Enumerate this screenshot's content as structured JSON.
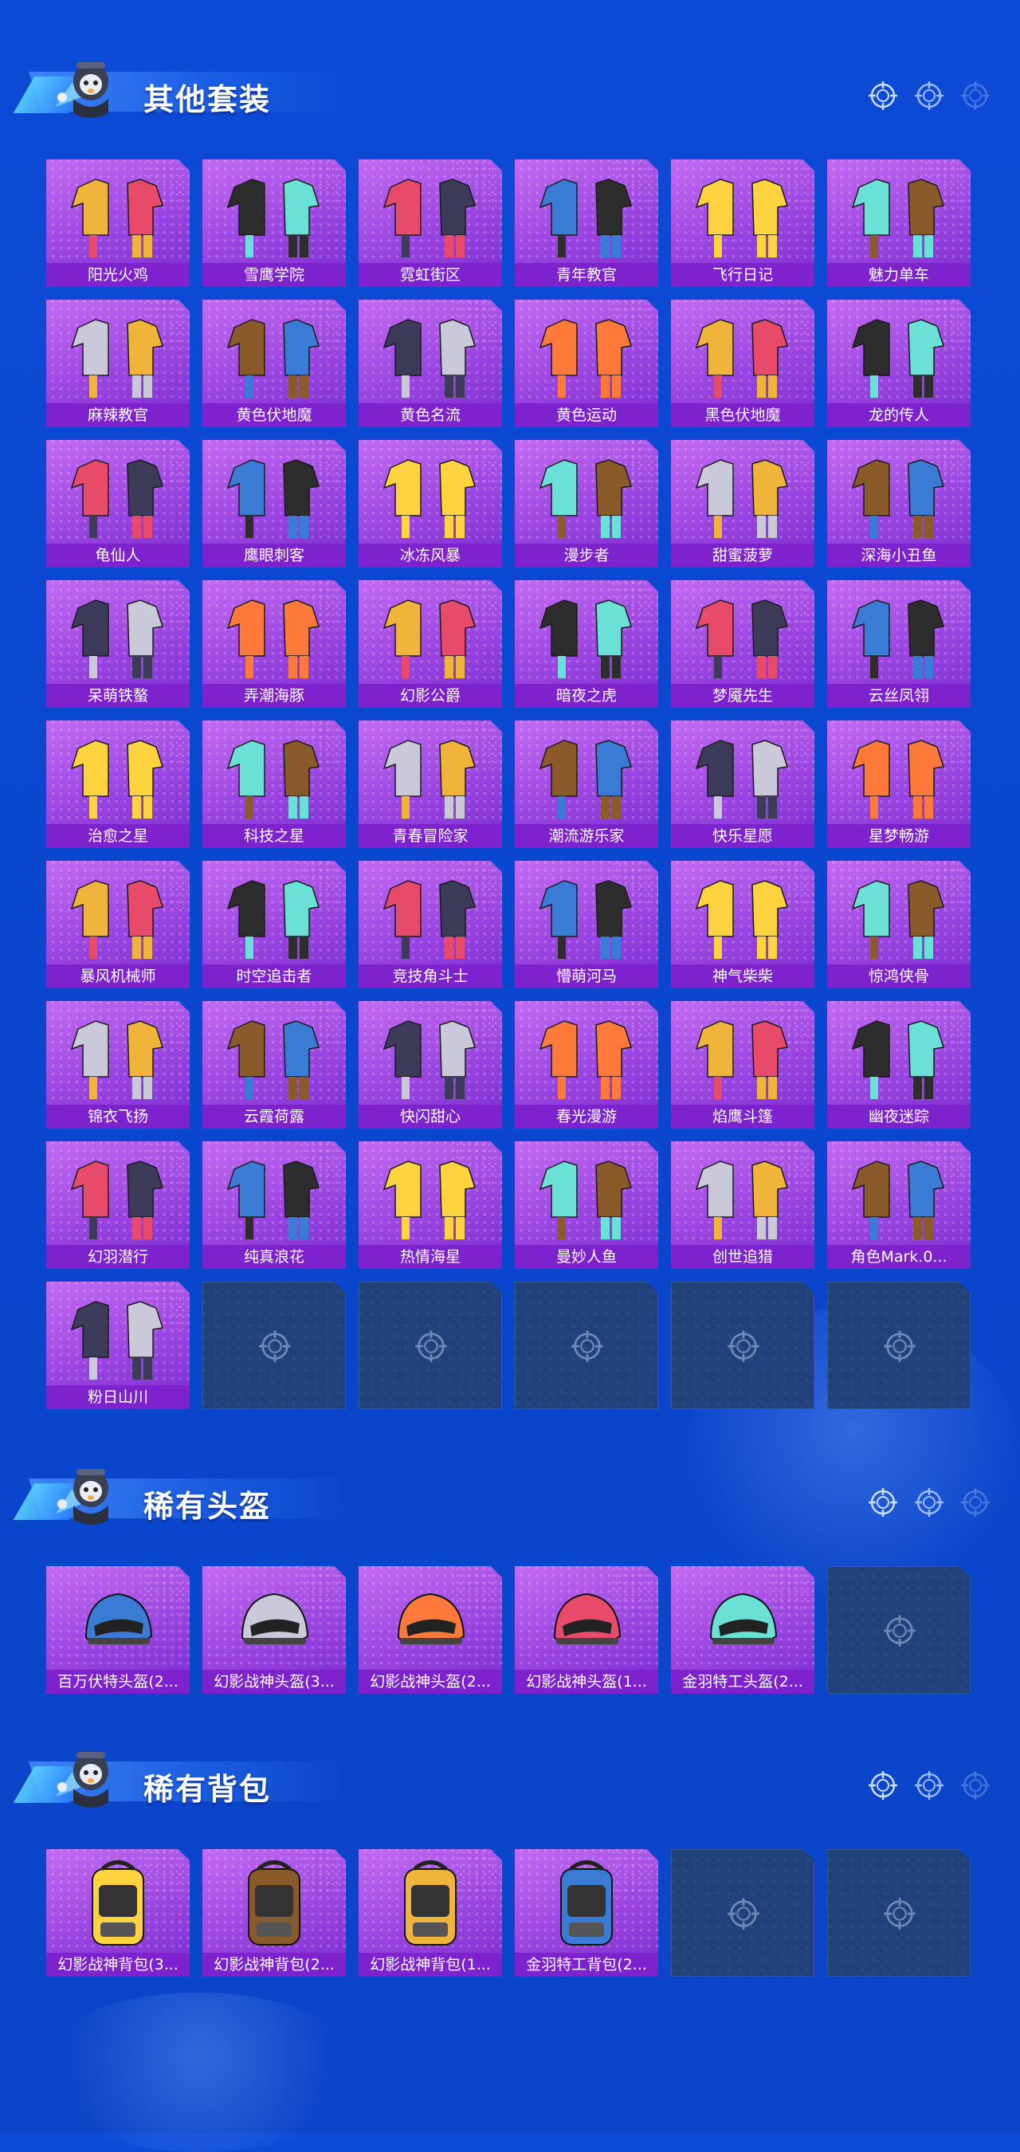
{
  "colors": {
    "background": "#0a47cf",
    "card_purple": "#a44fe6",
    "label_bar": "#7e22ce",
    "empty_card": "#20417a"
  },
  "sections": [
    {
      "title": "其他套装",
      "items": [
        "阳光火鸡",
        "雪鹰学院",
        "霓虹街区",
        "青年教官",
        "飞行日记",
        "魅力单车",
        "麻辣教官",
        "黄色伏地魔",
        "黄色名流",
        "黄色运动",
        "黑色伏地魔",
        "龙的传人",
        "龟仙人",
        "鹰眼刺客",
        "冰冻风暴",
        "漫步者",
        "甜蜜菠萝",
        "深海小丑鱼",
        "呆萌铁螯",
        "弄潮海豚",
        "幻影公爵",
        "暗夜之虎",
        "梦魇先生",
        "云丝凤翎",
        "治愈之星",
        "科技之星",
        "青春冒险家",
        "潮流游乐家",
        "快乐星愿",
        "星梦畅游",
        "暴风机械师",
        "时空追击者",
        "竞技角斗士",
        "懵萌河马",
        "神气柴柴",
        "惊鸿侠骨",
        "锦衣飞扬",
        "云霞荷露",
        "快闪甜心",
        "春光漫游",
        "焰鹰斗篷",
        "幽夜迷踪",
        "幻羽潜行",
        "纯真浪花",
        "热情海星",
        "曼妙人鱼",
        "创世追猎",
        "角色Mark.0...",
        "粉日山川"
      ],
      "empty_slots": 5
    },
    {
      "title": "稀有头盔",
      "items": [
        "百万伏特头盔(2...",
        "幻影战神头盔(3...",
        "幻影战神头盔(2...",
        "幻影战神头盔(1...",
        "金羽特工头盔(2..."
      ],
      "empty_slots": 1
    },
    {
      "title": "稀有背包",
      "items": [
        "幻影战神背包(3...",
        "幻影战神背包(2...",
        "幻影战神背包(1...",
        "金羽特工背包(2..."
      ],
      "empty_slots": 2
    }
  ],
  "icons": {
    "mascot": "mascot-avatar-icon",
    "header_decor": "crosshair-icon",
    "item": "outfit-thumbnail",
    "empty": "crosshair-icon"
  }
}
